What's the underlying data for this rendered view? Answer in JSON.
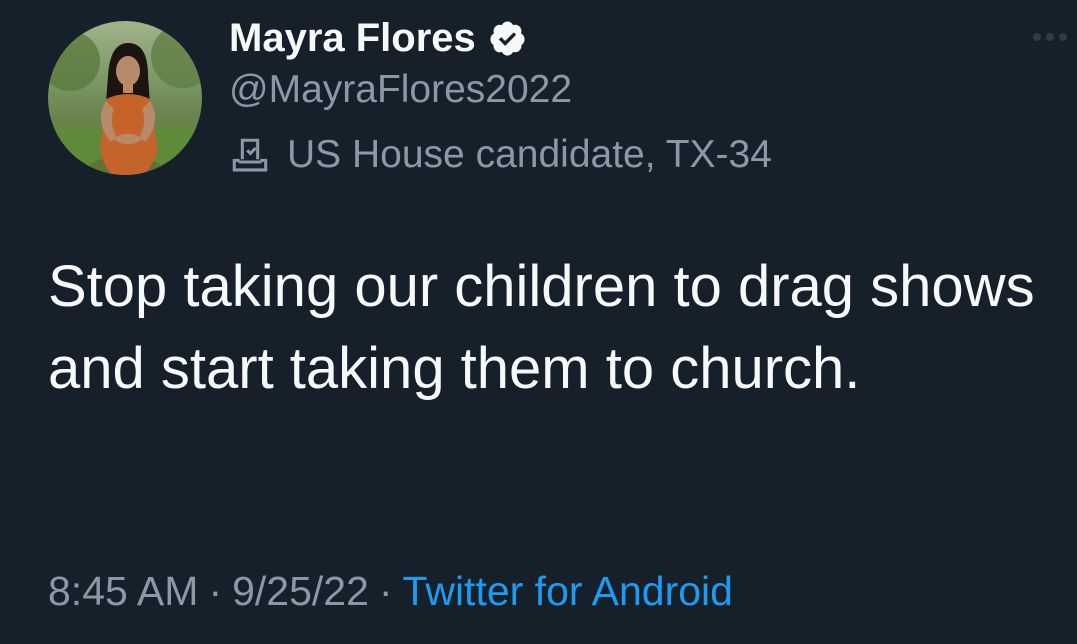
{
  "tweet": {
    "author": {
      "display_name": "Mayra Flores",
      "handle": "@MayraFlores2022",
      "verified": true,
      "category": "US House candidate, TX-34",
      "avatar_icon": "profile-photo"
    },
    "text": "Stop taking our children to drag shows and start taking them to church.",
    "time": "8:45 AM",
    "date": "9/25/22",
    "separator": "·",
    "source": "Twitter for Android",
    "more_icon": "more-dots-icon"
  },
  "colors": {
    "background": "#15202b",
    "primary_text": "#f7f9f9",
    "secondary_text": "#8b98a5",
    "link": "#1d9bf0"
  }
}
